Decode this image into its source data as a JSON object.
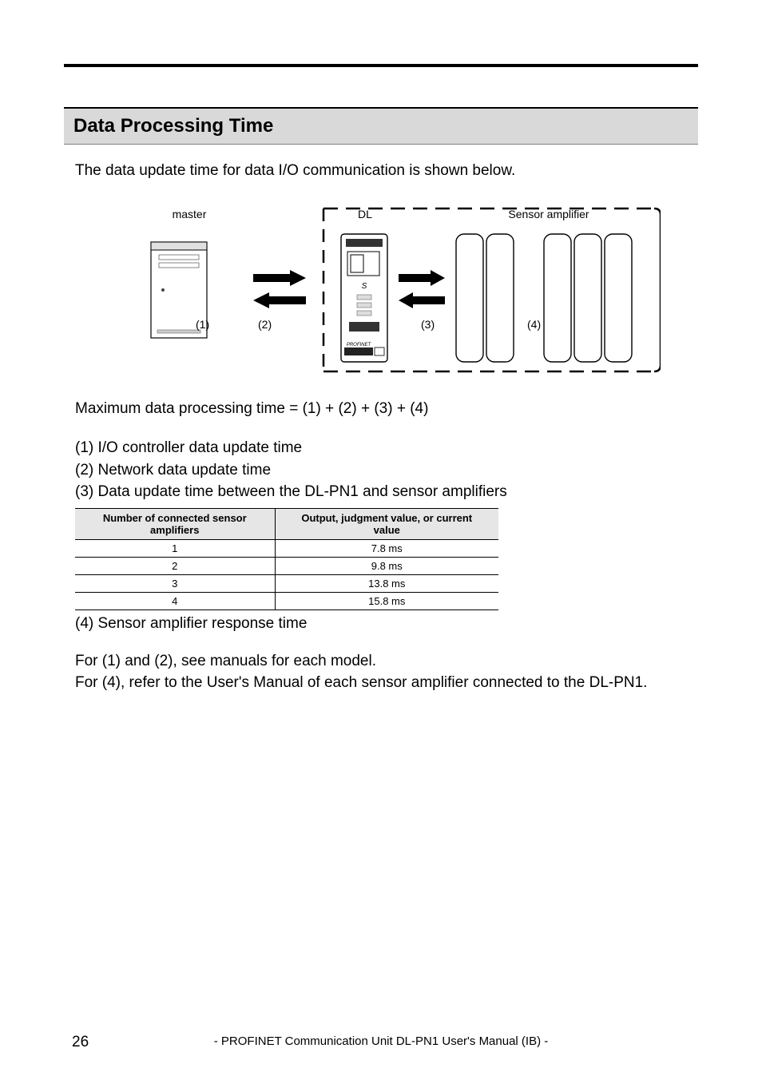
{
  "heading": "Data Processing Time",
  "intro": "The data update time for data I/O communication is shown below.",
  "diagram": {
    "master_label": "master",
    "dl_label": "DL",
    "sensor_label": "Sensor amplifier",
    "nums": {
      "one": "(1)",
      "two": "(2)",
      "three": "(3)",
      "four": "(4)"
    }
  },
  "formula": "Maximum data processing time = (1) + (2) + (3) + (4)",
  "list": {
    "item1": "(1)  I/O controller data update time",
    "item2": "(2)  Network data update time",
    "item3": "(3)  Data update time between the DL-PN1 and sensor amplifiers"
  },
  "table": {
    "head_a_l1": "Number of connected sensor",
    "head_a_l2": "amplifiers",
    "head_b_l1": "Output, judgment value, or current",
    "head_b_l2": "value",
    "rows": [
      {
        "a": "1",
        "b": "7.8 ms"
      },
      {
        "a": "2",
        "b": "9.8 ms"
      },
      {
        "a": "3",
        "b": "13.8 ms"
      },
      {
        "a": "4",
        "b": "15.8 ms"
      }
    ]
  },
  "after_table": "(4)  Sensor amplifier response time",
  "notes": {
    "l1": "For (1) and (2), see manuals for each model.",
    "l2": "For (4), refer to the User's Manual of each sensor amplifier connected to the DL-PN1."
  },
  "footer": "- PROFINET Communication Unit DL-PN1 User's Manual (IB) -",
  "page_num": "26"
}
